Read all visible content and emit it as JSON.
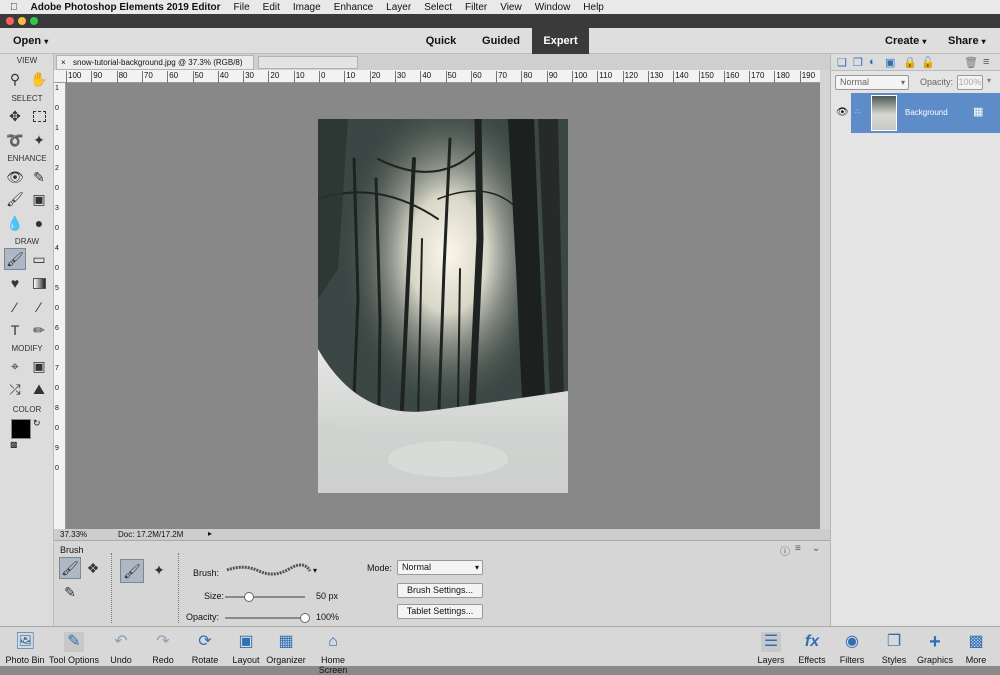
{
  "menubar": {
    "app": "Adobe Photoshop Elements 2019 Editor",
    "items": [
      "File",
      "Edit",
      "Image",
      "Enhance",
      "Layer",
      "Select",
      "Filter",
      "View",
      "Window",
      "Help"
    ]
  },
  "modebar": {
    "open": "Open",
    "tabs": [
      "Quick",
      "Guided",
      "Expert"
    ],
    "active_tab": "Expert",
    "create": "Create",
    "share": "Share"
  },
  "toolbox": {
    "sections": [
      "VIEW",
      "SELECT",
      "ENHANCE",
      "DRAW",
      "MODIFY",
      "COLOR"
    ]
  },
  "document": {
    "tab": "snow-tutorial-background.jpg @ 37.3% (RGB/8)",
    "zoom": "37.33%",
    "doc_size": "Doc: 17.2M/17.2M"
  },
  "ruler": {
    "h_labels": [
      "100",
      "90",
      "80",
      "70",
      "60",
      "50",
      "40",
      "30",
      "20",
      "10",
      "0",
      "10",
      "20",
      "30",
      "40",
      "50",
      "60",
      "70",
      "80",
      "90",
      "100",
      "110",
      "120",
      "130",
      "140",
      "150",
      "160",
      "170",
      "180",
      "190"
    ],
    "v_labels": [
      "1",
      "0",
      "1",
      "0",
      "2",
      "0",
      "3",
      "0",
      "4",
      "0",
      "5",
      "0",
      "6",
      "0",
      "7",
      "0",
      "8",
      "0",
      "9",
      "0"
    ]
  },
  "tool_options": {
    "title": "Brush",
    "brush_label": "Brush:",
    "size_label": "Size:",
    "size_value": "50 px",
    "size_fraction": 0.3,
    "opacity_label": "Opacity:",
    "opacity_value": "100%",
    "opacity_fraction": 1.0,
    "mode_label": "Mode:",
    "mode_value": "Normal",
    "brush_settings": "Brush Settings...",
    "tablet_settings": "Tablet Settings..."
  },
  "layers_panel": {
    "blend_mode": "Normal",
    "opacity_label": "Opacity:",
    "opacity_value": "100%",
    "layer_name": "Background"
  },
  "bottombar": {
    "left": [
      "Photo Bin",
      "Tool Options",
      "Undo",
      "Redo",
      "Rotate",
      "Layout",
      "Organizer",
      "Home Screen"
    ],
    "right": [
      "Layers",
      "Effects",
      "Filters",
      "Styles",
      "Graphics",
      "More"
    ]
  }
}
